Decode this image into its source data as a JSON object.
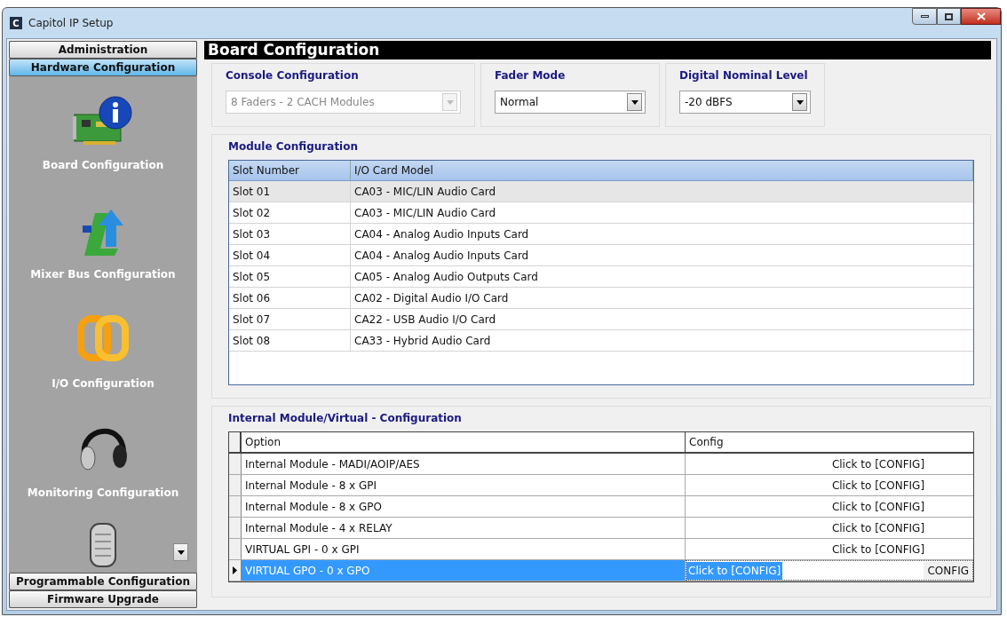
{
  "window": {
    "title": "Capitol IP Setup",
    "app_icon_letter": "C"
  },
  "sidebar": {
    "top_buttons": [
      {
        "label": "Administration",
        "selected": false
      },
      {
        "label": "Hardware Configuration",
        "selected": true
      }
    ],
    "items": [
      {
        "label": "Board Configuration"
      },
      {
        "label": "Mixer Bus Configuration"
      },
      {
        "label": "I/O Configuration"
      },
      {
        "label": "Monitoring Configuration"
      }
    ],
    "bottom_buttons": [
      {
        "label": "Programmable Configuration",
        "selected": false
      },
      {
        "label": "Firmware Upgrade",
        "selected": false
      }
    ]
  },
  "page_title": "Board Configuration",
  "settings": [
    {
      "label": "Console Configuration",
      "value": "8 Faders - 2 CACH Modules",
      "disabled": true
    },
    {
      "label": "Fader Mode",
      "value": "Normal",
      "disabled": false
    },
    {
      "label": "Digital Nominal Level",
      "value": "-20 dBFS",
      "disabled": false
    }
  ],
  "module_configuration": {
    "title": "Module Configuration",
    "columns": [
      "Slot Number",
      "I/O Card Model"
    ],
    "rows": [
      {
        "slot": "Slot 01",
        "model": "CA03 - MIC/LIN Audio Card",
        "selected": true
      },
      {
        "slot": "Slot 02",
        "model": "CA03 - MIC/LIN Audio Card",
        "selected": false
      },
      {
        "slot": "Slot 03",
        "model": "CA04 - Analog Audio Inputs Card",
        "selected": false
      },
      {
        "slot": "Slot 04",
        "model": "CA04 - Analog Audio Inputs Card",
        "selected": false
      },
      {
        "slot": "Slot 05",
        "model": "CA05 - Analog Audio Outputs Card",
        "selected": false
      },
      {
        "slot": "Slot 06",
        "model": "CA02 - Digital Audio I/O Card",
        "selected": false
      },
      {
        "slot": "Slot 07",
        "model": "CA22 - USB Audio I/O Card",
        "selected": false
      },
      {
        "slot": "Slot 08",
        "model": "CA33 - Hybrid Audio Card",
        "selected": false
      }
    ]
  },
  "internal_configuration": {
    "title": "Internal Module/Virtual - Configuration",
    "columns": [
      "Option",
      "Config"
    ],
    "rows": [
      {
        "option": "Internal Module - MADI/AOIP/AES",
        "config": "Click to [CONFIG]",
        "selected": false
      },
      {
        "option": "Internal Module - 8 x GPI",
        "config": "Click to [CONFIG]",
        "selected": false
      },
      {
        "option": "Internal Module - 8 x GPO",
        "config": "Click to [CONFIG]",
        "selected": false
      },
      {
        "option": "Internal Module - 4 x RELAY",
        "config": "Click to [CONFIG]",
        "selected": false
      },
      {
        "option": "VIRTUAL GPI - 0 x GPI",
        "config": "Click to [CONFIG]",
        "selected": false
      },
      {
        "option": "VIRTUAL GPO - 0 x GPO",
        "config": "Click to [CONFIG]",
        "selected": true,
        "button": "CONFIG"
      }
    ]
  }
}
